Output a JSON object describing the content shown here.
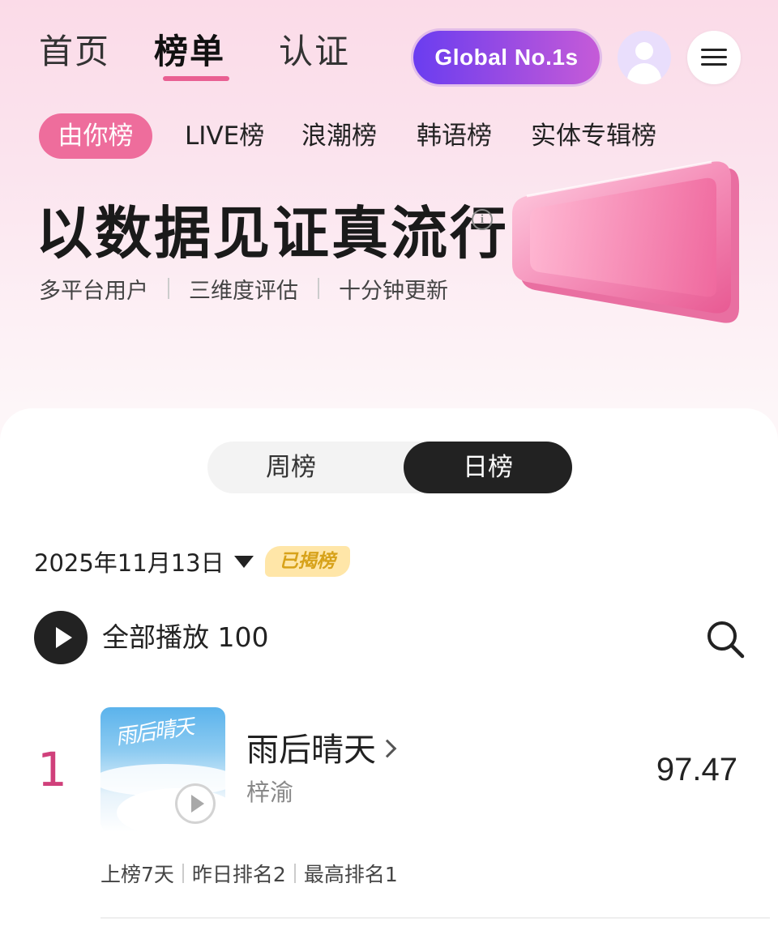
{
  "top_nav": {
    "tabs": [
      {
        "label": "首页"
      },
      {
        "label": "榜单"
      },
      {
        "label": "认证"
      }
    ],
    "active_tab": "榜单",
    "global_button_label": "Global No.1s"
  },
  "sub_tabs": {
    "items": [
      "由你榜",
      "LIVE榜",
      "浪潮榜",
      "韩语榜",
      "实体专辑榜"
    ],
    "active": "由你榜"
  },
  "hero": {
    "title": "以数据见证真流行",
    "features": [
      "多平台用户",
      "三维度评估",
      "十分钟更新"
    ]
  },
  "period_toggle": {
    "options": [
      "周榜",
      "日榜"
    ],
    "selected": "日榜"
  },
  "chart_date": {
    "date": "2025年11月13日",
    "status_badge": "已揭榜"
  },
  "play_all": {
    "label": "全部播放",
    "count": "100"
  },
  "entries": [
    {
      "rank": "1",
      "title": "雨后晴天",
      "artist": "梓渝",
      "score": "97.47",
      "stats": [
        "上榜7天",
        "昨日排名2",
        "最高排名1"
      ]
    }
  ],
  "colors": {
    "accent_pink": "#ee6d9c",
    "rank_pink": "#d0407b",
    "global_gradient_start": "#6a3df0",
    "global_gradient_end": "#c55bd8",
    "badge_bg": "#ffe6a8",
    "badge_text": "#d7a21a"
  }
}
